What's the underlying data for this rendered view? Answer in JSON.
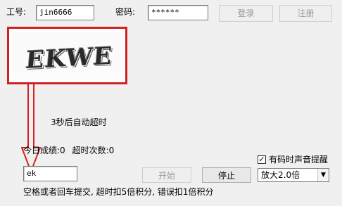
{
  "login": {
    "employee_id_label": "工号:",
    "employee_id_value": "jin6666",
    "password_label": "密码:",
    "password_value": "******",
    "login_button": "登录",
    "register_button": "注册"
  },
  "captcha": {
    "text": "EKWE"
  },
  "timer": {
    "timeout_notice": "3秒后自动超时"
  },
  "stats": {
    "today_score_label": "今日成绩:",
    "today_score_value": "0",
    "timeout_count_label": "超时次数:",
    "timeout_count_value": "0"
  },
  "answer": {
    "input_value": "ek"
  },
  "controls": {
    "start_button": "开始",
    "stop_button": "停止",
    "sound_alert_label": "有码时声音提醒",
    "sound_alert_checked": true,
    "zoom_select_value": "放大2.0倍"
  },
  "footer": {
    "instructions": "空格或者回车提交, 超时扣5倍积分, 错误扣1倍积分"
  },
  "colors": {
    "annotation": "#d32020"
  }
}
